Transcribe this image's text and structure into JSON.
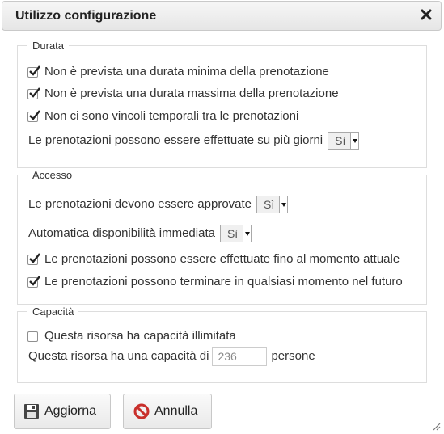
{
  "dialog": {
    "title": "Utilizzo configurazione",
    "close_icon": "close-icon"
  },
  "durata": {
    "legend": "Durata",
    "checks": [
      {
        "label": "Non è prevista una durata minima della prenotazione",
        "checked": true
      },
      {
        "label": "Non è prevista una durata massima della prenotazione",
        "checked": true
      },
      {
        "label": "Non ci sono vincoli temporali tra le prenotazioni",
        "checked": true
      }
    ],
    "multi_day": {
      "label": "Le prenotazioni possono essere effettuate su più giorni",
      "selected": "Sì"
    }
  },
  "accesso": {
    "legend": "Accesso",
    "approval": {
      "label": "Le prenotazioni devono essere approvate",
      "selected": "Sì"
    },
    "auto_avail": {
      "label": "Automatica disponibilità immediata",
      "selected": "Sì"
    },
    "checks": [
      {
        "label": "Le prenotazioni possono essere effettuate fino al momento attuale",
        "checked": true
      },
      {
        "label": "Le prenotazioni possono terminare in qualsiasi momento nel futuro",
        "checked": true
      }
    ]
  },
  "capacita": {
    "legend": "Capacità",
    "unlimited": {
      "label": "Questa risorsa ha capacità illimitata",
      "checked": false
    },
    "capacity": {
      "prefix": "Questa risorsa ha una capacità di",
      "value": "236",
      "suffix": "persone"
    }
  },
  "buttons": {
    "update": {
      "label": "Aggiorna",
      "icon": "floppy-disk-icon"
    },
    "cancel": {
      "label": "Annulla",
      "icon": "cancel-icon"
    }
  },
  "colors": {
    "cancel_icon": "#c9302c",
    "accent_text": "#222222"
  }
}
